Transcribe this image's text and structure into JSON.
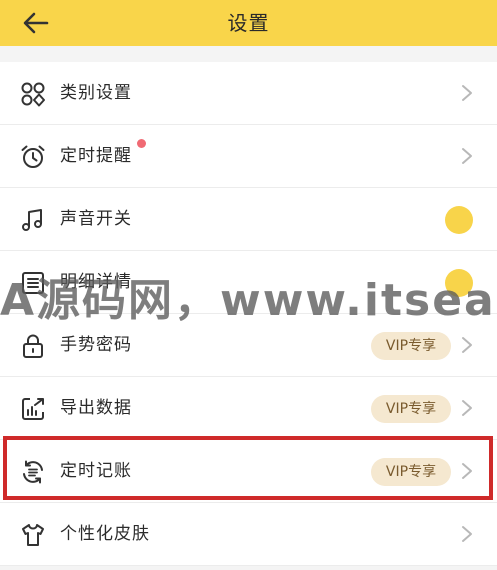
{
  "header": {
    "title": "设置"
  },
  "colors": {
    "header_bg": "#f9d54a",
    "toggle": "#f8d44a",
    "badge_bg": "#f5e8d0",
    "highlight": "#cf2a2a",
    "red_dot": "#f06a74"
  },
  "settings": {
    "items": [
      {
        "label": "类别设置",
        "icon": "category-icon"
      },
      {
        "label": "定时提醒",
        "icon": "alarm-clock-icon",
        "notification_dot": true
      },
      {
        "label": "声音开关",
        "icon": "music-note-icon",
        "toggle_on": true
      },
      {
        "label": "明细详情",
        "icon": "detail-list-icon",
        "toggle_on": true
      },
      {
        "label": "手势密码",
        "icon": "lock-icon",
        "badge": "VIP专享"
      },
      {
        "label": "导出数据",
        "icon": "export-data-icon",
        "badge": "VIP专享"
      },
      {
        "label": "定时记账",
        "icon": "scheduled-bookkeeping-icon",
        "badge": "VIP专享",
        "highlighted": true
      },
      {
        "label": "个性化皮肤",
        "icon": "tshirt-icon"
      }
    ]
  },
  "watermark": {
    "text": "A源码网，www.itsear.co"
  }
}
